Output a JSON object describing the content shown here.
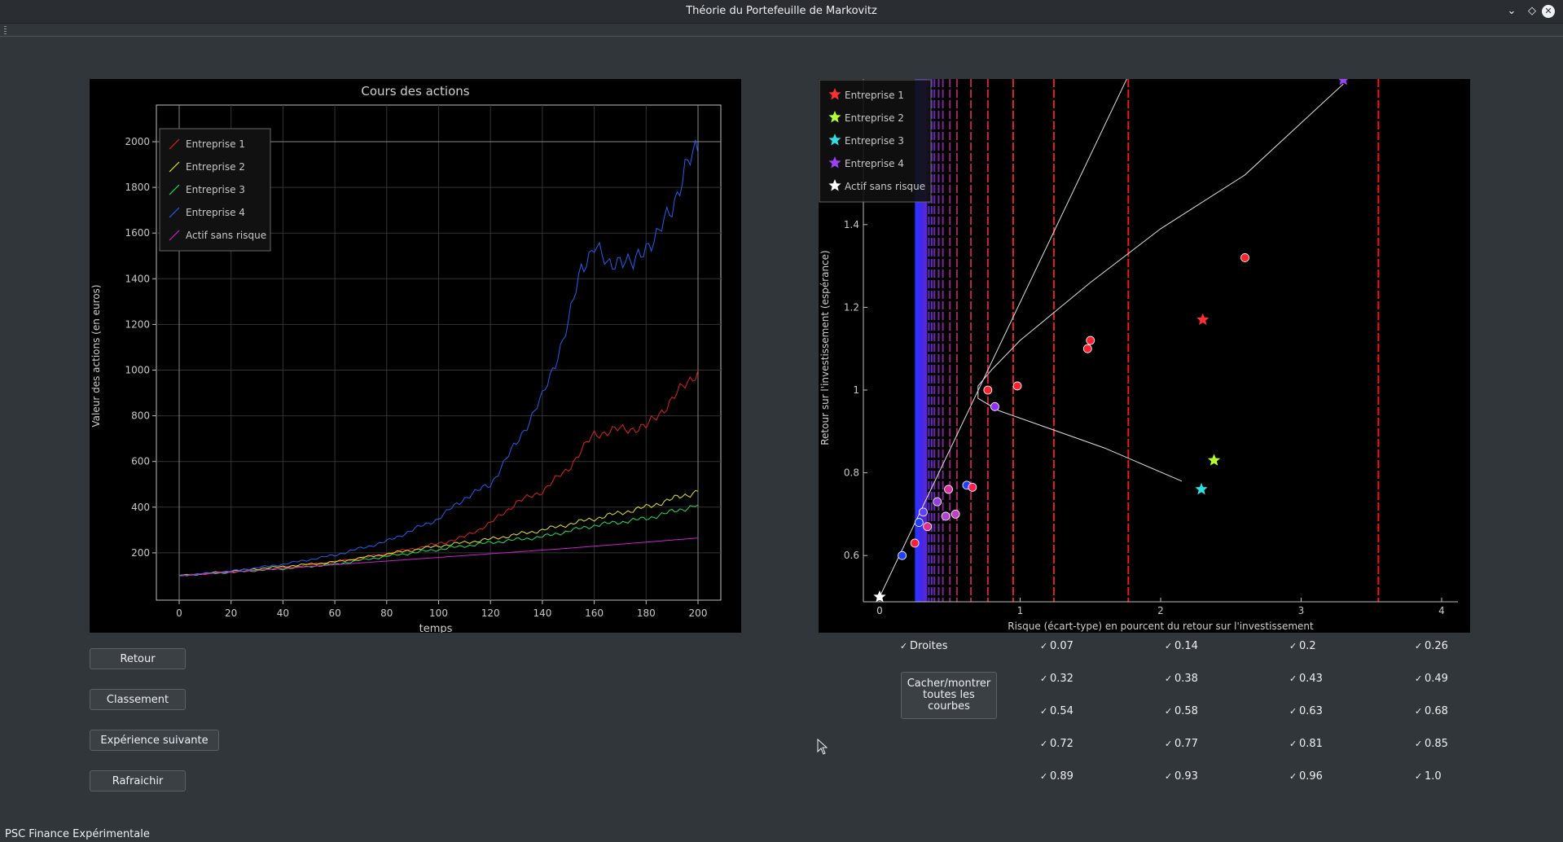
{
  "window": {
    "title": "Théorie du Portefeuille de Markovitz"
  },
  "status_text": "PSC Finance Expérimentale",
  "buttons": {
    "retour": "Retour",
    "classement": "Classement",
    "experience": "Expérience suivante",
    "rafraichir": "Rafraichir",
    "toggle_line1": "Cacher/montrer",
    "toggle_line2": "toutes les courbes"
  },
  "checkboxes": {
    "droites": "Droites",
    "values": [
      "0.07",
      "0.14",
      "0.2",
      "0.26",
      "0.32",
      "0.38",
      "0.43",
      "0.49",
      "0.54",
      "0.58",
      "0.63",
      "0.68",
      "0.72",
      "0.77",
      "0.81",
      "0.85",
      "0.89",
      "0.93",
      "0.96",
      "1.0"
    ]
  },
  "chart_data": [
    {
      "type": "line",
      "title": "Cours des actions",
      "xlabel": "temps",
      "ylabel": "Valeur des actions (en euros)",
      "xlim": [
        0,
        200
      ],
      "ylim": [
        0,
        2000
      ],
      "xticks": [
        0,
        20,
        40,
        60,
        80,
        100,
        120,
        140,
        160,
        180,
        200
      ],
      "yticks": [
        200,
        400,
        600,
        800,
        1000,
        1200,
        1400,
        1600,
        1800,
        2000
      ],
      "grid": true,
      "legend_position": "top-left",
      "series": [
        {
          "name": "Entreprise 1",
          "color": "#e02020",
          "points": [
            [
              0,
              100
            ],
            [
              20,
              115
            ],
            [
              40,
              135
            ],
            [
              60,
              160
            ],
            [
              80,
              195
            ],
            [
              100,
              240
            ],
            [
              110,
              270
            ],
            [
              120,
              330
            ],
            [
              130,
              420
            ],
            [
              140,
              470
            ],
            [
              150,
              570
            ],
            [
              160,
              720
            ],
            [
              170,
              740
            ],
            [
              180,
              750
            ],
            [
              190,
              870
            ],
            [
              200,
              1000
            ]
          ]
        },
        {
          "name": "Entreprise 2",
          "color": "#e6e620",
          "points": [
            [
              0,
              100
            ],
            [
              20,
              120
            ],
            [
              40,
              140
            ],
            [
              60,
              160
            ],
            [
              80,
              195
            ],
            [
              100,
              230
            ],
            [
              120,
              260
            ],
            [
              140,
              300
            ],
            [
              160,
              350
            ],
            [
              180,
              400
            ],
            [
              200,
              470
            ]
          ]
        },
        {
          "name": "Entreprise 3",
          "color": "#20e060",
          "points": [
            [
              0,
              100
            ],
            [
              20,
              115
            ],
            [
              40,
              130
            ],
            [
              60,
              150
            ],
            [
              80,
              185
            ],
            [
              100,
              215
            ],
            [
              120,
              245
            ],
            [
              140,
              270
            ],
            [
              160,
              320
            ],
            [
              180,
              350
            ],
            [
              200,
              410
            ]
          ]
        },
        {
          "name": "Entreprise 4",
          "color": "#2060f0",
          "points": [
            [
              0,
              100
            ],
            [
              20,
              120
            ],
            [
              40,
              150
            ],
            [
              60,
              190
            ],
            [
              80,
              250
            ],
            [
              90,
              300
            ],
            [
              100,
              350
            ],
            [
              110,
              440
            ],
            [
              120,
              500
            ],
            [
              130,
              680
            ],
            [
              140,
              880
            ],
            [
              150,
              1200
            ],
            [
              155,
              1450
            ],
            [
              160,
              1550
            ],
            [
              165,
              1450
            ],
            [
              170,
              1500
            ],
            [
              175,
              1450
            ],
            [
              180,
              1550
            ],
            [
              185,
              1600
            ],
            [
              190,
              1700
            ],
            [
              195,
              1900
            ],
            [
              200,
              1950
            ]
          ]
        },
        {
          "name": "Actif sans risque",
          "color": "#d020d0",
          "points": [
            [
              0,
              100
            ],
            [
              50,
              140
            ],
            [
              100,
              180
            ],
            [
              150,
              220
            ],
            [
              200,
              265
            ]
          ]
        }
      ]
    },
    {
      "type": "scatter",
      "xlabel": "Risque (écart-type) en pourcent du retour sur l'investissement",
      "ylabel": "Retour sur l'investissement (espérance)",
      "xlim": [
        -0.1,
        4.0
      ],
      "ylim": [
        0.5,
        1.75
      ],
      "xticks": [
        "0",
        "1",
        "2",
        "3",
        "4"
      ],
      "yticks": [
        "0.6",
        "0.8",
        "1",
        "1.2",
        "1.4"
      ],
      "legend_position": "top-left",
      "legend": [
        {
          "name": "Entreprise 1",
          "color": "#ff3030"
        },
        {
          "name": "Entreprise 2",
          "color": "#b0ff30"
        },
        {
          "name": "Entreprise 3",
          "color": "#30e0e0"
        },
        {
          "name": "Entreprise 4",
          "color": "#a040ff"
        },
        {
          "name": "Actif sans risque",
          "color": "#ffffff"
        }
      ],
      "stars": [
        {
          "x": 2.3,
          "y": 1.17,
          "color": "#ff3030"
        },
        {
          "x": 2.38,
          "y": 0.83,
          "color": "#b0ff30"
        },
        {
          "x": 2.29,
          "y": 0.76,
          "color": "#30e0e0"
        },
        {
          "x": 3.3,
          "y": 1.75,
          "color": "#a040ff"
        },
        {
          "x": 0.0,
          "y": 0.5,
          "color": "#ffffff"
        }
      ],
      "points": [
        {
          "x": 2.6,
          "y": 1.32,
          "color": "#ff2030"
        },
        {
          "x": 1.5,
          "y": 1.12,
          "color": "#ff2030"
        },
        {
          "x": 1.48,
          "y": 1.1,
          "color": "#ff2030"
        },
        {
          "x": 0.98,
          "y": 1.01,
          "color": "#ff2030"
        },
        {
          "x": 0.77,
          "y": 1.0,
          "color": "#ff2030"
        },
        {
          "x": 0.82,
          "y": 0.96,
          "color": "#9030ff"
        },
        {
          "x": 0.62,
          "y": 0.77,
          "color": "#2040ff"
        },
        {
          "x": 0.66,
          "y": 0.765,
          "color": "#ff2050"
        },
        {
          "x": 0.49,
          "y": 0.76,
          "color": "#e030a0"
        },
        {
          "x": 0.41,
          "y": 0.73,
          "color": "#9040e0"
        },
        {
          "x": 0.54,
          "y": 0.7,
          "color": "#c040c0"
        },
        {
          "x": 0.47,
          "y": 0.695,
          "color": "#b040d0"
        },
        {
          "x": 0.31,
          "y": 0.705,
          "color": "#6040ff"
        },
        {
          "x": 0.28,
          "y": 0.68,
          "color": "#2040ff"
        },
        {
          "x": 0.34,
          "y": 0.67,
          "color": "#e03090"
        },
        {
          "x": 0.25,
          "y": 0.63,
          "color": "#ff2040"
        },
        {
          "x": 0.16,
          "y": 0.6,
          "color": "#2040ff"
        }
      ],
      "vertical_lines": [
        {
          "x": 0.26,
          "color": "#3030ff"
        },
        {
          "x": 0.27,
          "color": "#3030ff"
        },
        {
          "x": 0.28,
          "color": "#3030ff"
        },
        {
          "x": 0.29,
          "color": "#3a2cf0"
        },
        {
          "x": 0.3,
          "color": "#4028e8"
        },
        {
          "x": 0.31,
          "color": "#4828e0"
        },
        {
          "x": 0.32,
          "color": "#5028d8"
        },
        {
          "x": 0.33,
          "color": "#5828d0"
        },
        {
          "x": 0.35,
          "color": "#6028c8"
        },
        {
          "x": 0.37,
          "color": "#6828c0"
        },
        {
          "x": 0.39,
          "color": "#7028b0"
        },
        {
          "x": 0.42,
          "color": "#7828a0"
        },
        {
          "x": 0.45,
          "color": "#802890"
        },
        {
          "x": 0.5,
          "color": "#902878"
        },
        {
          "x": 0.55,
          "color": "#a02868"
        },
        {
          "x": 0.65,
          "color": "#b82850"
        },
        {
          "x": 0.77,
          "color": "#d02838"
        },
        {
          "x": 0.95,
          "color": "#e02828"
        },
        {
          "x": 1.24,
          "color": "#e82020"
        },
        {
          "x": 1.77,
          "color": "#f01818"
        },
        {
          "x": 3.55,
          "color": "#ff1010"
        }
      ],
      "frontier": [
        [
          2.15,
          0.78
        ],
        [
          1.6,
          0.86
        ],
        [
          1.1,
          0.92
        ],
        [
          0.85,
          0.95
        ],
        [
          0.7,
          0.98
        ],
        [
          0.7,
          1.01
        ],
        [
          0.8,
          1.05
        ],
        [
          1.0,
          1.12
        ],
        [
          1.5,
          1.26
        ],
        [
          2.0,
          1.39
        ],
        [
          2.6,
          1.52
        ],
        [
          3.3,
          1.74
        ]
      ],
      "tangent_line": [
        [
          0.0,
          0.5
        ],
        [
          1.77,
          1.76
        ]
      ]
    }
  ]
}
